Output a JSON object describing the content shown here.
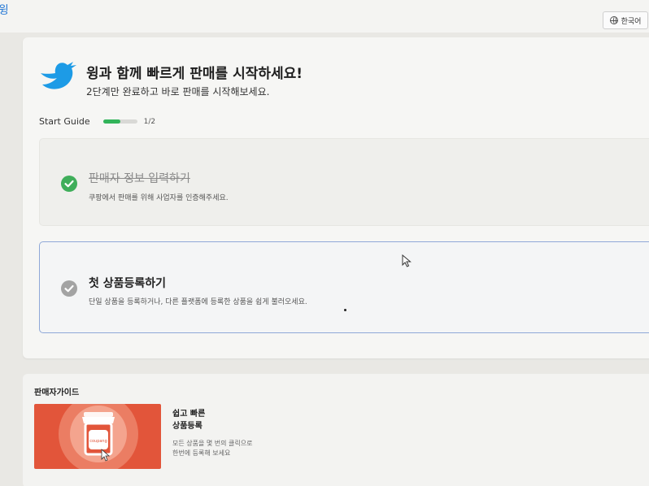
{
  "topbar": {
    "brand_fragment": "윙",
    "language": "한국어",
    "language_icon": "globe-icon"
  },
  "hero": {
    "logo_icon": "bird-logo-icon",
    "title": "윙과 함께 빠르게 판매를 시작하세요!",
    "subtitle": "2단계만 완료하고 바로 판매를 시작해보세요."
  },
  "start_guide": {
    "label": "Start Guide",
    "progress_text": "1/2",
    "progress_fraction": 0.5,
    "progress_color": "#32b45a"
  },
  "steps": [
    {
      "title": "판매자 정보 입력하기",
      "description": "쿠팡에서 판매를 위해 사업자를 인증해주세요.",
      "completed": true,
      "check_color": "#3fae5a"
    },
    {
      "title": "첫 상품등록하기",
      "description": "단일 상품을 등록하거나, 다른 플랫폼에 등록한 상품을 쉽게 불러오세요.",
      "completed": false,
      "check_color": "#a3a3a3"
    }
  ],
  "seller_guide": {
    "heading": "판매자가이드",
    "card": {
      "title_line1": "쉽고 빠른",
      "title_line2": "상품등록",
      "desc_line1": "모든 상품을 몇 번의 클릭으로",
      "desc_line2": "한번에 등록해 보세요",
      "banner_color": "#e2553a",
      "shop_label": "coupang"
    }
  }
}
